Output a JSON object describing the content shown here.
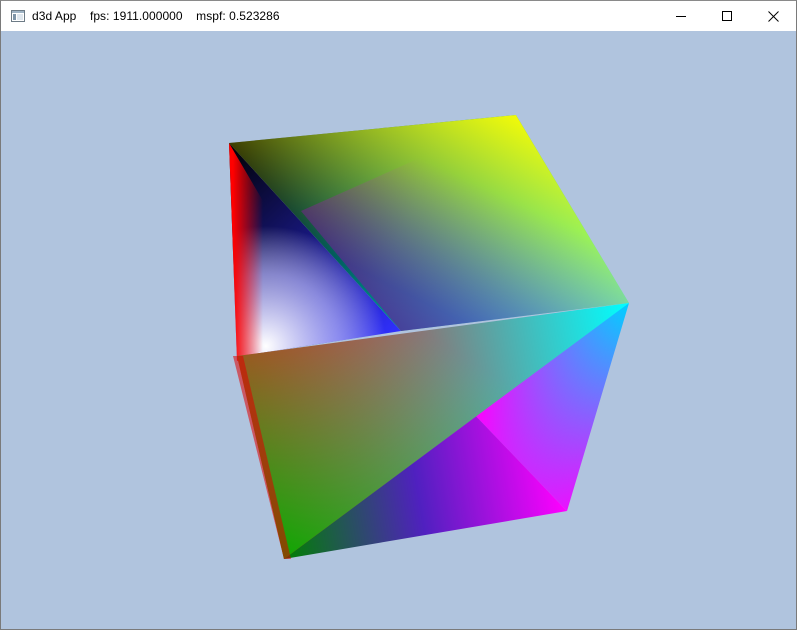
{
  "window": {
    "title": "d3d App",
    "fps_text": "fps: 1911.000000",
    "mspf_text": "mspf: 0.523286",
    "app_icon": "window-app-icon",
    "controls": {
      "minimize_icon": "minimize-icon",
      "maximize_icon": "maximize-icon",
      "close_icon": "close-icon"
    }
  },
  "scene": {
    "background_color": "#B0C4DE",
    "object": "rotating vertex-colored cube",
    "vertex_colors": [
      "#000000",
      "#FFFFFF",
      "#FF0000",
      "#00FF00",
      "#0000FF",
      "#FFFF00",
      "#00FFFF",
      "#FF00FF"
    ]
  }
}
